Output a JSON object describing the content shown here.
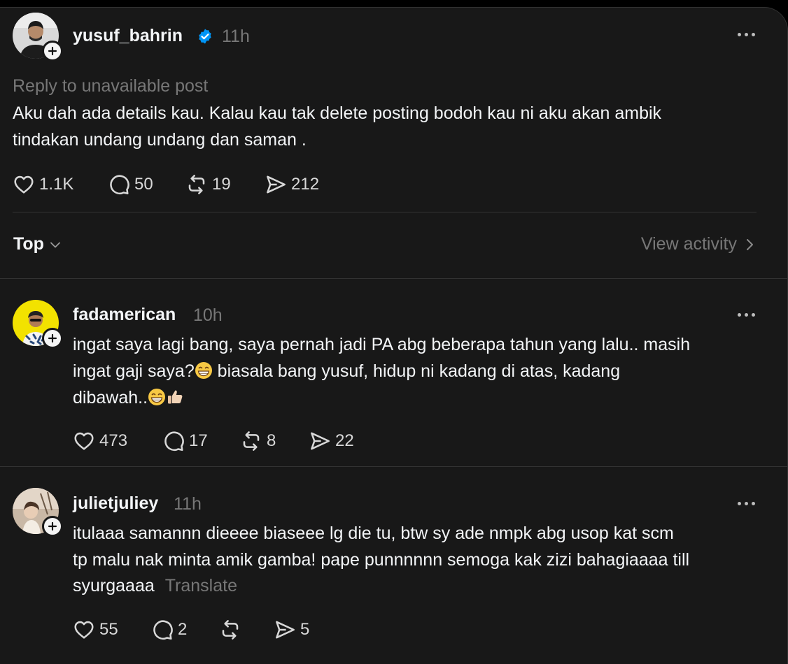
{
  "main_post": {
    "username": "yusuf_bahrin",
    "verified": true,
    "time": "11h",
    "reply_context": "Reply to unavailable post",
    "text_line1": "Aku dah ada details kau. Kalau kau tak delete posting bodoh kau ni aku akan ambik",
    "text_line2": "tindakan undang undang dan saman .",
    "likes": "1.1K",
    "replies": "50",
    "reposts": "19",
    "shares": "212"
  },
  "sort_bar": {
    "sort_label": "Top",
    "view_activity_label": "View activity"
  },
  "comments": [
    {
      "username": "fadamerican",
      "time": "10h",
      "line1": "ingat saya lagi bang, saya pernah jadi PA abg beberapa tahun yang lalu.. masih",
      "line2a": "ingat gaji saya?",
      "line2b": " biasala bang yusuf, hidup ni kadang di atas, kadang",
      "line3": "dibawah..",
      "likes": "473",
      "replies": "17",
      "reposts": "8",
      "shares": "22"
    },
    {
      "username": "julietjuliey",
      "time": "11h",
      "line1": "itulaaa samannn dieeee biaseee lg die tu, btw sy ade nmpk abg usop kat scm",
      "line2": "tp malu nak minta amik gamba! pape punnnnnn semoga kak zizi bahagiaaaa till",
      "line3": "syurgaaaa",
      "translate_label": "Translate",
      "likes": "55",
      "replies": "2",
      "reposts": "",
      "shares": "5"
    }
  ],
  "icons": {
    "like": "heart-icon",
    "reply": "comment-icon",
    "repost": "repost-icon",
    "share": "share-icon",
    "verified": "verified-badge-icon",
    "follow": "plus-icon",
    "more": "more-icon",
    "sort": "chevron-down-icon",
    "activity": "chevron-right-icon"
  },
  "colors": {
    "background": "#181818",
    "text": "#f3f5f7",
    "muted": "#777777",
    "verified": "#0095f6",
    "divider": "#323232"
  }
}
